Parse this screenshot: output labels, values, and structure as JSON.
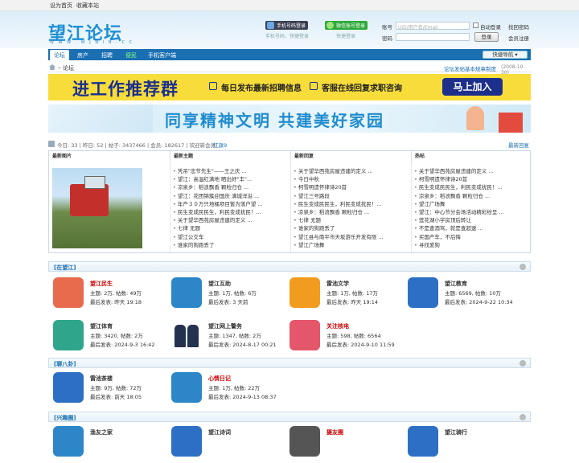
{
  "topbar": {
    "set_home": "设为首页",
    "bookmark": "收藏本站"
  },
  "header": {
    "logo": "望江论坛",
    "logo_sub": "W W W . W J N I N - C C",
    "phone_login": "手机号码登录",
    "wechat_login": "微信账号登录",
    "phone_sub": "手机号码，快捷登录",
    "wechat_sub": "快捷登录",
    "account_label": "账号",
    "account_placeholder": "UID/用户名/Email",
    "auto_login": "自动登录",
    "find_pwd": "找回密码",
    "pwd_label": "密码",
    "login_btn": "登录",
    "register": "会员注册"
  },
  "nav": {
    "items": [
      "论坛",
      "房产",
      "招聘",
      "便民",
      "手机客户端"
    ],
    "quick": "快捷导航"
  },
  "crumb": {
    "home_icon": "home-icon",
    "current": "论坛",
    "notice": "论坛发帖基本规章制度",
    "notice_date": "(2008-10-30)"
  },
  "banner1": {
    "title": "进工作推荐群",
    "line1": "每日发布最新招聘信息",
    "line2": "客服在线回复求职咨询",
    "cta": "马上加入"
  },
  "banner2": {
    "title": "同享精神文明  共建美好家园"
  },
  "stats": {
    "text": "今日: 33 | 昨日: 52 | 帖子: 3437466 | 会员: 182617 | 欢迎新会员:",
    "new_member": "红旗9",
    "latest_reply": "最新回复"
  },
  "cols": {
    "image": "最新图片",
    "topics": "最新主题",
    "replies": "最新回复",
    "hot": "热帖"
  },
  "topics": [
    "凭吊\"忠节先生\"——王之庆 ...",
    "望江：高温红满地 晒出好\"丰\"...",
    "凉泉乡：稻浪飘香 颗粒归仓 ...",
    "望江：花团锦簇迎国庆 满城洋溢 ...",
    "年产３０万只地桶项目暂为落户望 ...",
    "民生变成民民生，利民变成扰民！...",
    "关于望华西苑房屋违建的定义 ...",
    "七律 无题",
    "望江公交车",
    "谁家的狗跑丢了"
  ],
  "replies": [
    "关于望华西苑房屋违建的定义 ...",
    "今日中秋",
    "柯雪明遗怀律诗20首",
    "望江三号路段",
    "民生变成民民生，利民变成扰民！...",
    "凉泉乡：稻浪飘香 颗粒归仓 ...",
    "七律 无题",
    "谁家的狗跑丢了",
    "望江县与南平市天坂游乐开发有限 ...",
    "望江广场舞"
  ],
  "hot": [
    "关于望华西苑房屋违建的定义 ...",
    "柯雪明遗怀律诗20首",
    "民生变成民民生，利民变成扰民！...",
    "凉泉乡：稻浪飘香 颗粒归仓 ...",
    "望江广场舞",
    "望江：中心节分会场活动精彩纷呈 ...",
    "莲花湖小学房顶后转让",
    "不是查酒驾，就是查超速 ...",
    "买国产车，不后悔",
    "寻找爱狗"
  ],
  "sections": [
    {
      "title": "[在望江]",
      "forums": [
        {
          "name": "望江民生",
          "stats": "主题: 2万, 帖数: 49万",
          "last": "最后发表: 昨天 19:18",
          "color": "#e86b4e",
          "icon": "chat-bubbles-icon",
          "red": true
        },
        {
          "name": "望江互助",
          "stats": "主题: 1万, 帖数: 6万",
          "last": "最后发表: 3 天前",
          "color": "#2d86c8",
          "icon": "people-talk-icon",
          "red": false
        },
        {
          "name": "雷池文学",
          "stats": "主题: 1万, 帖数: 17万",
          "last": "最后发表: 昨天 19:14",
          "color": "#f29c1f",
          "icon": "book-icon",
          "red": false
        },
        {
          "name": "望江教育",
          "stats": "主题: 6569, 帖数: 10万",
          "last": "最后发表: 2024-9-22 10:34",
          "color": "#2d6fc4",
          "icon": "graduation-cap-icon",
          "red": false
        },
        {
          "name": "望江体育",
          "stats": "主题: 3420, 帖数: 2万",
          "last": "最后发表: 2024-9-3 16:42",
          "color": "#2fa58c",
          "icon": "basketball-icon",
          "red": false
        },
        {
          "name": "望江网上警务",
          "stats": "主题: 1347, 帖数: 2万",
          "last": "最后发表: 2024-8-17 00:21",
          "color": "#ffffff",
          "icon": "police-icon",
          "red": false
        },
        {
          "name": "关注核电",
          "stats": "主题: 598, 帖数: 6564",
          "last": "最后发表: 2024-9-10 11:59",
          "color": "#e4576a",
          "icon": "star-icon",
          "red": true
        }
      ]
    },
    {
      "title": "[聊八卦]",
      "forums": [
        {
          "name": "雷池茶楼",
          "stats": "主题: 9万, 帖数: 72万",
          "last": "最后发表: 前天 18:05",
          "color": "#2d6fc4",
          "icon": "coffee-cup-icon",
          "red": false
        },
        {
          "name": "心情日记",
          "stats": "主题: 1万, 帖数: 22万",
          "last": "最后发表: 2024-9-13 08:37",
          "color": "#2d86c8",
          "icon": "heart-icon",
          "red": true
        }
      ]
    },
    {
      "title": "[兴趣圈]",
      "forums": [
        {
          "name": "渔友之家",
          "color": "#2d86c8",
          "red": false
        },
        {
          "name": "望江诗词",
          "color": "#2d6fc4",
          "red": false
        },
        {
          "name": "摄友圈",
          "color": "#555555",
          "red": true
        },
        {
          "name": "望江骑行",
          "color": "#2d6fc4",
          "red": false
        }
      ]
    }
  ]
}
